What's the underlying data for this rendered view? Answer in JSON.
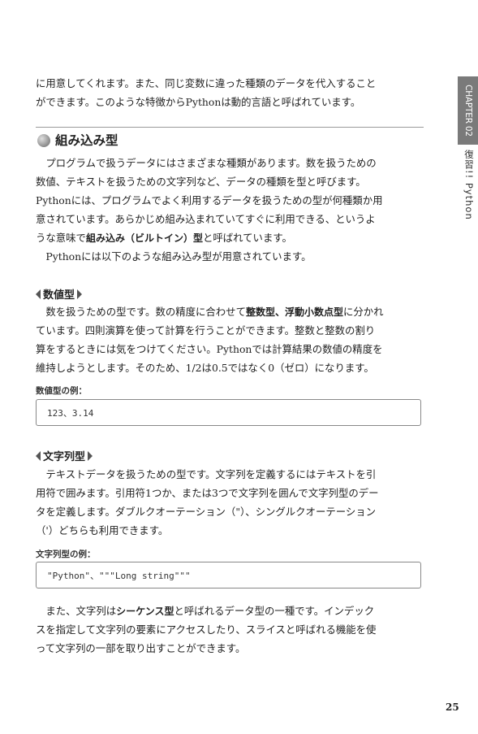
{
  "side": {
    "chapter": "CHAPTER 02",
    "title": "復習!! Python"
  },
  "intro": {
    "line1": "に用意してくれます。また、同じ変数に違った種類のデータを代入すること",
    "line2": "ができます。このような特徴からPythonは動的言語と呼ばれています。"
  },
  "section": {
    "title": "組み込み型",
    "para1": {
      "l1": "　プログラムで扱うデータにはさまざまな種類があります。数を扱うための",
      "l2": "数値、テキストを扱うための文字列など、データの種類を型と呼びます。",
      "l3": "Pythonには、プログラムでよく利用するデータを扱うための型が何種類か用",
      "l4": "意されています。あらかじめ組み込まれていてすぐに利用できる、というよ",
      "l5a": "うな意味で",
      "l5b": "組み込み（ビルトイン）型",
      "l5c": "と呼ばれています。"
    },
    "para2": "　Pythonには以下のような組み込み型が用意されています。"
  },
  "numeric": {
    "heading": "数値型",
    "l1a": "　数を扱うための型です。数の精度に合わせて",
    "l1b": "整数型",
    "l1c": "、",
    "l1d": "浮動小数点型",
    "l1e": "に分かれ",
    "l2": "ています。四則演算を使って計算を行うことができます。整数と整数の割り",
    "l3": "算をするときには気をつけてください。Pythonでは計算結果の数値の精度を",
    "l4": "維持しようとします。そのため、1/2は0.5ではなく0（ゼロ）になります。",
    "example_label": "数値型の例：",
    "example_code": "123、3.14"
  },
  "string": {
    "heading": "文字列型",
    "l1": "　テキストデータを扱うための型です。文字列を定義するにはテキストを引",
    "l2": "用符で囲みます。引用符1つか、または3つで文字列を囲んで文字列型のデー",
    "l3": "タを定義します。ダブルクオーテーション（\"）、シングルクオーテーション",
    "l4": "（'）どちらも利用できます。",
    "example_label": "文字列型の例：",
    "example_code": "\"Python\"、\"\"\"Long string\"\"\""
  },
  "closing": {
    "l1a": "　また、文字列は",
    "l1b": "シーケンス型",
    "l1c": "と呼ばれるデータ型の一種です。インデック",
    "l2": "スを指定して文字列の要素にアクセスしたり、スライスと呼ばれる機能を使",
    "l3": "って文字列の一部を取り出すことができます。"
  },
  "page_number": "25"
}
